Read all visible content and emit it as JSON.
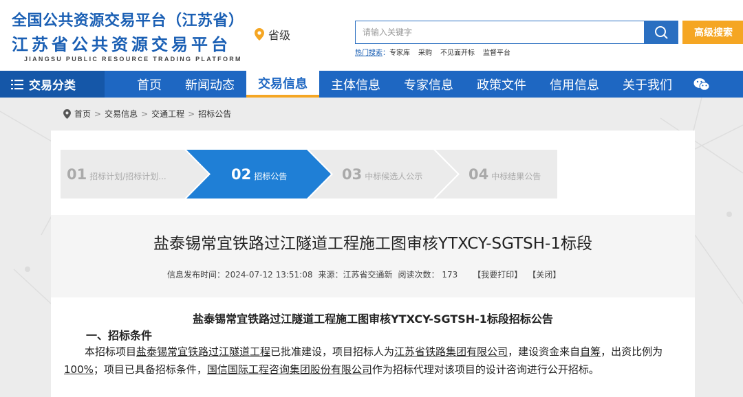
{
  "header": {
    "logo_line1": "全国公共资源交易平台（江苏省）",
    "logo_line2": "江苏省公共资源交易平台",
    "logo_line3": "JIANGSU PUBLIC RESOURCE TRADING PLATFORM",
    "location": "省级",
    "search_placeholder": "请输入关键字",
    "advanced_search": "高级搜索",
    "hot_label": "热门搜索",
    "hot_sep": "：",
    "hot_items": [
      "专家库",
      "采购",
      "不见面开标",
      "监督平台"
    ]
  },
  "nav": {
    "category": "交易分类",
    "items": [
      "首页",
      "新闻动态",
      "交易信息",
      "主体信息",
      "专家信息",
      "政策文件",
      "信用信息",
      "关于我们"
    ],
    "active_index": 2
  },
  "breadcrumb": [
    "首页",
    "交易信息",
    "交通工程",
    "招标公告"
  ],
  "steps": [
    {
      "num": "01",
      "label": "招标计划/招标计划..."
    },
    {
      "num": "02",
      "label": "招标公告"
    },
    {
      "num": "03",
      "label": "中标候选人公示"
    },
    {
      "num": "04",
      "label": "中标结果公告"
    }
  ],
  "active_step": 1,
  "document": {
    "title": "盐泰锡常宜铁路过江隧道工程施工图审核YTXCY-SGTSH-1标段",
    "publish_time_label": "信息发布时间：",
    "publish_time": "2024-07-12 13:51:08",
    "source_label": "来源：",
    "source": "江苏省交通新",
    "views_label": "阅读次数：",
    "views": "173",
    "print_action": "【我要打印】",
    "close_action": "【关闭】",
    "content_title": "盐泰锡常宜铁路过江隧道工程施工图审核YTXCY-SGTSH-1标段招标公告",
    "section1_heading": "一、招标条件",
    "para": {
      "t1": "本招标项目",
      "project": "盐泰锡常宜铁路过江隧道工程",
      "t2": "已批准建设，项目招标人为",
      "tenderer": "江苏省铁路集团有限公司",
      "t3": "，建设资金来自",
      "fund": "自筹",
      "t4": "，出资比例为",
      "ratio": "100%",
      "t5": "；项目已具备招标条件，",
      "agent": "国信国际工程咨询集团股份有限公司",
      "t6": "作为招标代理对该项目的设计咨询进行公开招标。"
    }
  },
  "colors": {
    "brand_blue": "#1e67c2",
    "accent_orange": "#f5a623",
    "step_active": "#1f7fd6",
    "step_inactive": "#ebebeb"
  }
}
